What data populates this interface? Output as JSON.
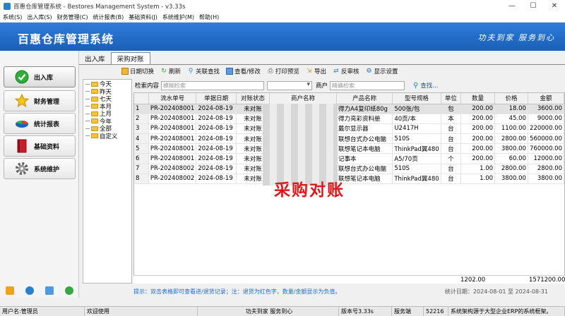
{
  "window": {
    "title": "百惠仓库管理系统 - Bestores Management System - v3.33s"
  },
  "menu": [
    "系统(S)",
    "出入库(S)",
    "财务管理(C)",
    "统计报表(B)",
    "基础资料(J)",
    "系统维护(M)",
    "帮助(H)"
  ],
  "banner": {
    "title": "百惠仓库管理系统",
    "slogan": "功夫到家 服务到心"
  },
  "nav": [
    {
      "label": "出入库",
      "icon": "check-circle-icon",
      "active": true
    },
    {
      "label": "财务管理",
      "icon": "star-icon",
      "active": false
    },
    {
      "label": "统计报表",
      "icon": "pie-chart-icon",
      "active": false
    },
    {
      "label": "基础资料",
      "icon": "book-icon",
      "active": false
    },
    {
      "label": "系统维护",
      "icon": "gear-icon",
      "active": false
    }
  ],
  "tabs": [
    {
      "label": "出入库",
      "active": false
    },
    {
      "label": "采购对账",
      "active": true
    }
  ],
  "toolbar": [
    {
      "label": "日期切换",
      "icon": "calendar-icon"
    },
    {
      "label": "刷新",
      "icon": "refresh-icon"
    },
    {
      "label": "关联查找",
      "icon": "link-search-icon"
    },
    {
      "label": "查看/修改",
      "icon": "edit-icon"
    },
    {
      "label": "打印预览",
      "icon": "print-icon"
    },
    {
      "label": "导出",
      "icon": "export-icon"
    },
    {
      "label": "反审核",
      "icon": "undo-icon"
    },
    {
      "label": "显示设置",
      "icon": "settings-icon"
    }
  ],
  "tree": [
    "今天",
    "昨天",
    "七天",
    "本月",
    "上月",
    "今年",
    "全部",
    "自定义"
  ],
  "filter": {
    "content_label": "检索内容",
    "content_placeholder": "模糊检索",
    "vendor_label": "商户",
    "vendor_placeholder": "精确检索",
    "search_label": "查找..."
  },
  "table": {
    "columns": [
      "",
      "流水单号",
      "单据日期",
      "对账状态",
      "商户名称",
      "产品名称",
      "型号规格",
      "单位",
      "数量",
      "价格",
      "金额"
    ],
    "rows": [
      [
        "1",
        "PR-202408001",
        "2024-08-19",
        "未对账",
        "",
        "得力A4复印纸80g",
        "500张/包",
        "包",
        "200.00",
        "18.00",
        "3600.00"
      ],
      [
        "2",
        "PR-202408001",
        "2024-08-19",
        "未对账",
        "",
        "得力亮彩资料册",
        "40页/本",
        "本",
        "200.00",
        "45.00",
        "9000.00"
      ],
      [
        "3",
        "PR-202408001",
        "2024-08-19",
        "未对账",
        "",
        "戴尔显示器",
        "U2417H",
        "台",
        "200.00",
        "1100.00",
        "220000.00"
      ],
      [
        "4",
        "PR-202408001",
        "2024-08-19",
        "未对账",
        "",
        "联想台式办公电脑",
        "510S",
        "台",
        "200.00",
        "2800.00",
        "560000.00"
      ],
      [
        "5",
        "PR-202408001",
        "2024-08-19",
        "未对账",
        "",
        "联想笔记本电脑",
        "ThinkPad翼480",
        "台",
        "200.00",
        "3800.00",
        "760000.00"
      ],
      [
        "6",
        "PR-202408001",
        "2024-08-19",
        "未对账",
        "",
        "记事本",
        "A5/70页",
        "个",
        "200.00",
        "60.00",
        "12000.00"
      ],
      [
        "7",
        "PR-202408002",
        "2024-08-19",
        "未对账",
        "",
        "联想台式办公电脑",
        "510S",
        "台",
        "1.00",
        "2800.00",
        "2800.00"
      ],
      [
        "8",
        "PR-202408002",
        "2024-08-19",
        "未对账",
        "",
        "联想笔记本电脑",
        "ThinkPad翼480",
        "台",
        "1.00",
        "3800.00",
        "3800.00"
      ]
    ],
    "total_qty": "1202.00",
    "total_amount": "1571200.00"
  },
  "overlay_text": "采购对账",
  "hint": {
    "text": "提示：双击表格即可查看进/退货记录；注：退货为红色字，数量/金额显示为负值。",
    "period": "统计日期：2024-08-01 至 2024-08-31"
  },
  "status": [
    "用户名:管理员",
    "欢迎使用",
    "功夫到家 服务到心",
    "版本号3.33s",
    "服务端",
    "52216",
    "系统架构源于大型企业ERP的系统框架。"
  ],
  "colors": {
    "banner": "#1f6ac6",
    "accent": "#e0161a",
    "hint": "#1a6cd8"
  }
}
